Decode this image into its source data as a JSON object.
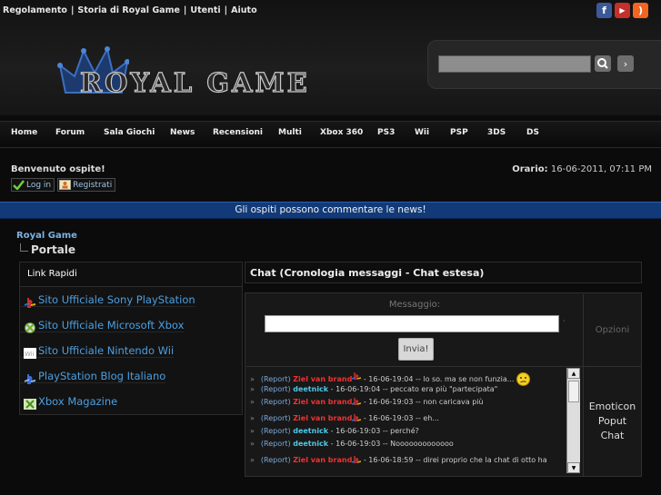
{
  "top_links": [
    "Regolamento",
    "Storia di Royal Game",
    "Utenti",
    "Aiuto"
  ],
  "top_links_separator": "|",
  "social": [
    {
      "icon": "facebook-icon",
      "glyph": "f",
      "color": "#3b5998"
    },
    {
      "icon": "youtube-icon",
      "glyph": "▶",
      "color": "#c4302b"
    },
    {
      "icon": "rss-icon",
      "glyph": ")",
      "color": "#f26522"
    }
  ],
  "logo": {
    "text": "ROYAL GAME"
  },
  "search": {
    "placeholder": "",
    "go_label": "›"
  },
  "nav": [
    "Home",
    "Forum",
    "Sala Giochi",
    "News",
    "Recensioni",
    "Multi",
    "Xbox 360",
    "PS3",
    "Wii",
    "PSP",
    "3DS",
    "DS"
  ],
  "welcome": {
    "text": "Benvenuto ospite!",
    "login_label": "Log in",
    "register_label": "Registrati"
  },
  "clock": {
    "label": "Orario:",
    "value": "16-06-2011, 07:11 PM"
  },
  "banner": "Gli ospiti possono commentare le news!",
  "breadcrumb": {
    "root": "Royal Game",
    "current": "Portale"
  },
  "quick_links": {
    "title": "Link Rapidi",
    "items": [
      {
        "label": "Sito Ufficiale Sony PlayStation",
        "icon": "playstation-icon"
      },
      {
        "label": "Sito Ufficiale Microsoft Xbox",
        "icon": "xbox-icon"
      },
      {
        "label": "Sito Ufficiale Nintendo Wii",
        "icon": "wii-icon"
      },
      {
        "label": "PlayStation Blog Italiano",
        "icon": "playstation-icon"
      },
      {
        "label": "Xbox Magazine",
        "icon": "xbox-icon"
      }
    ]
  },
  "chat": {
    "title": "Chat (Cronologia messaggi - Chat estesa)",
    "message_label": "Messaggio:",
    "send_label": "Invia!",
    "options_label": "Opzioni",
    "emoticon_label_lines": [
      "Emoticon",
      "Poput",
      "Chat"
    ],
    "messages": [
      {
        "bullet": "»",
        "report": "(Report)",
        "user": "Ziel van brand",
        "user_color": "red",
        "time": "16-06-19:04",
        "text": "lo so. ma se non funzia..."
      },
      {
        "bullet": "»",
        "report": "(Report)",
        "user": "deetnick",
        "user_color": "cyan",
        "time": "16-06-19:04",
        "text": "peccato era più \"partecipata\""
      },
      {
        "bullet": "»",
        "report": "(Report)",
        "user": "Ziel van brand",
        "user_color": "red",
        "time": "16-06-19:03",
        "text": "non caricava più"
      },
      {
        "bullet": "»",
        "report": "(Report)",
        "user": "Ziel van brand",
        "user_color": "red",
        "time": "16-06-19:03",
        "text": "eh..."
      },
      {
        "bullet": "»",
        "report": "(Report)",
        "user": "deetnick",
        "user_color": "cyan",
        "time": "16-06-19:03",
        "text": "perché?"
      },
      {
        "bullet": "»",
        "report": "(Report)",
        "user": "deetnick",
        "user_color": "cyan",
        "time": "16-06-19:03",
        "text": "Nooooooooooooo"
      },
      {
        "bullet": "»",
        "report": "(Report)",
        "user": "Ziel van brand",
        "user_color": "red",
        "time": "16-06-18:59",
        "text": "direi proprio che la chat di otto ha"
      }
    ]
  }
}
